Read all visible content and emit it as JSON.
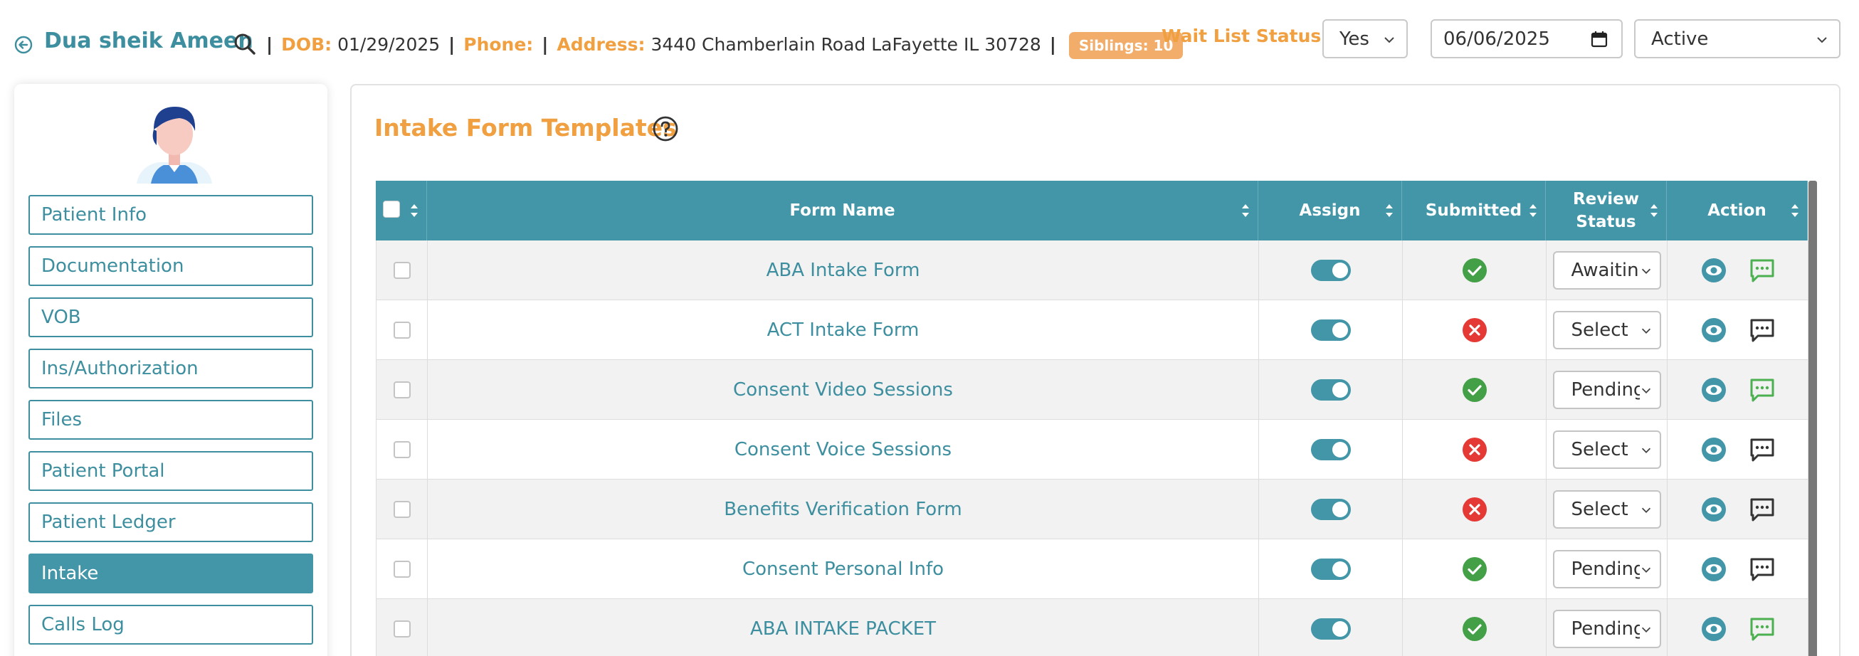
{
  "header": {
    "patient_name": "Dua sheik Ameen",
    "dob_label": "DOB:",
    "dob": "01/29/2025",
    "phone_label": "Phone:",
    "phone": "",
    "address_label": "Address:",
    "address": "3440 Chamberlain Road LaFayette IL 30728",
    "siblings": "Siblings: 10",
    "wait_list_label": "Wait List Status:",
    "wait_list_value": "Yes",
    "date_value": "06/06/2025",
    "status_value": "Active"
  },
  "sidebar": {
    "items": [
      {
        "label": "Patient Info",
        "active": false
      },
      {
        "label": "Documentation",
        "active": false
      },
      {
        "label": "VOB",
        "active": false
      },
      {
        "label": "Ins/Authorization",
        "active": false
      },
      {
        "label": "Files",
        "active": false
      },
      {
        "label": "Patient Portal",
        "active": false
      },
      {
        "label": "Patient Ledger",
        "active": false
      },
      {
        "label": "Intake",
        "active": true
      },
      {
        "label": "Calls Log",
        "active": false
      }
    ]
  },
  "main": {
    "title": "Intake Form Templates",
    "columns": {
      "form_name": "Form Name",
      "assign": "Assign",
      "submitted": "Submitted",
      "review_status": "Review Status",
      "action": "Action"
    },
    "rows": [
      {
        "name": "ABA Intake Form",
        "assigned": true,
        "submitted": true,
        "review": "Awaiting",
        "comment_color": "#4caf50"
      },
      {
        "name": "ACT Intake Form",
        "assigned": true,
        "submitted": false,
        "review": "Select",
        "comment_color": "#333333"
      },
      {
        "name": "Consent Video Sessions",
        "assigned": true,
        "submitted": true,
        "review": "Pending",
        "comment_color": "#4caf50"
      },
      {
        "name": "Consent Voice Sessions",
        "assigned": true,
        "submitted": false,
        "review": "Select",
        "comment_color": "#333333"
      },
      {
        "name": "Benefits Verification Form",
        "assigned": true,
        "submitted": false,
        "review": "Select",
        "comment_color": "#333333"
      },
      {
        "name": "Consent Personal Info",
        "assigned": true,
        "submitted": true,
        "review": "Pending",
        "comment_color": "#333333"
      },
      {
        "name": "ABA INTAKE PACKET",
        "assigned": true,
        "submitted": true,
        "review": "Pending",
        "comment_color": "#4caf50"
      }
    ]
  },
  "colors": {
    "teal": "#4296a8",
    "orange": "#f0a040",
    "success": "#43a047",
    "error": "#e53935"
  },
  "icons": {
    "back": "back-circle-icon",
    "search": "search-icon",
    "help": "help-circle-icon",
    "view": "eye-icon",
    "comment": "comment-icon",
    "check": "check-circle-icon",
    "cross": "x-circle-icon"
  }
}
